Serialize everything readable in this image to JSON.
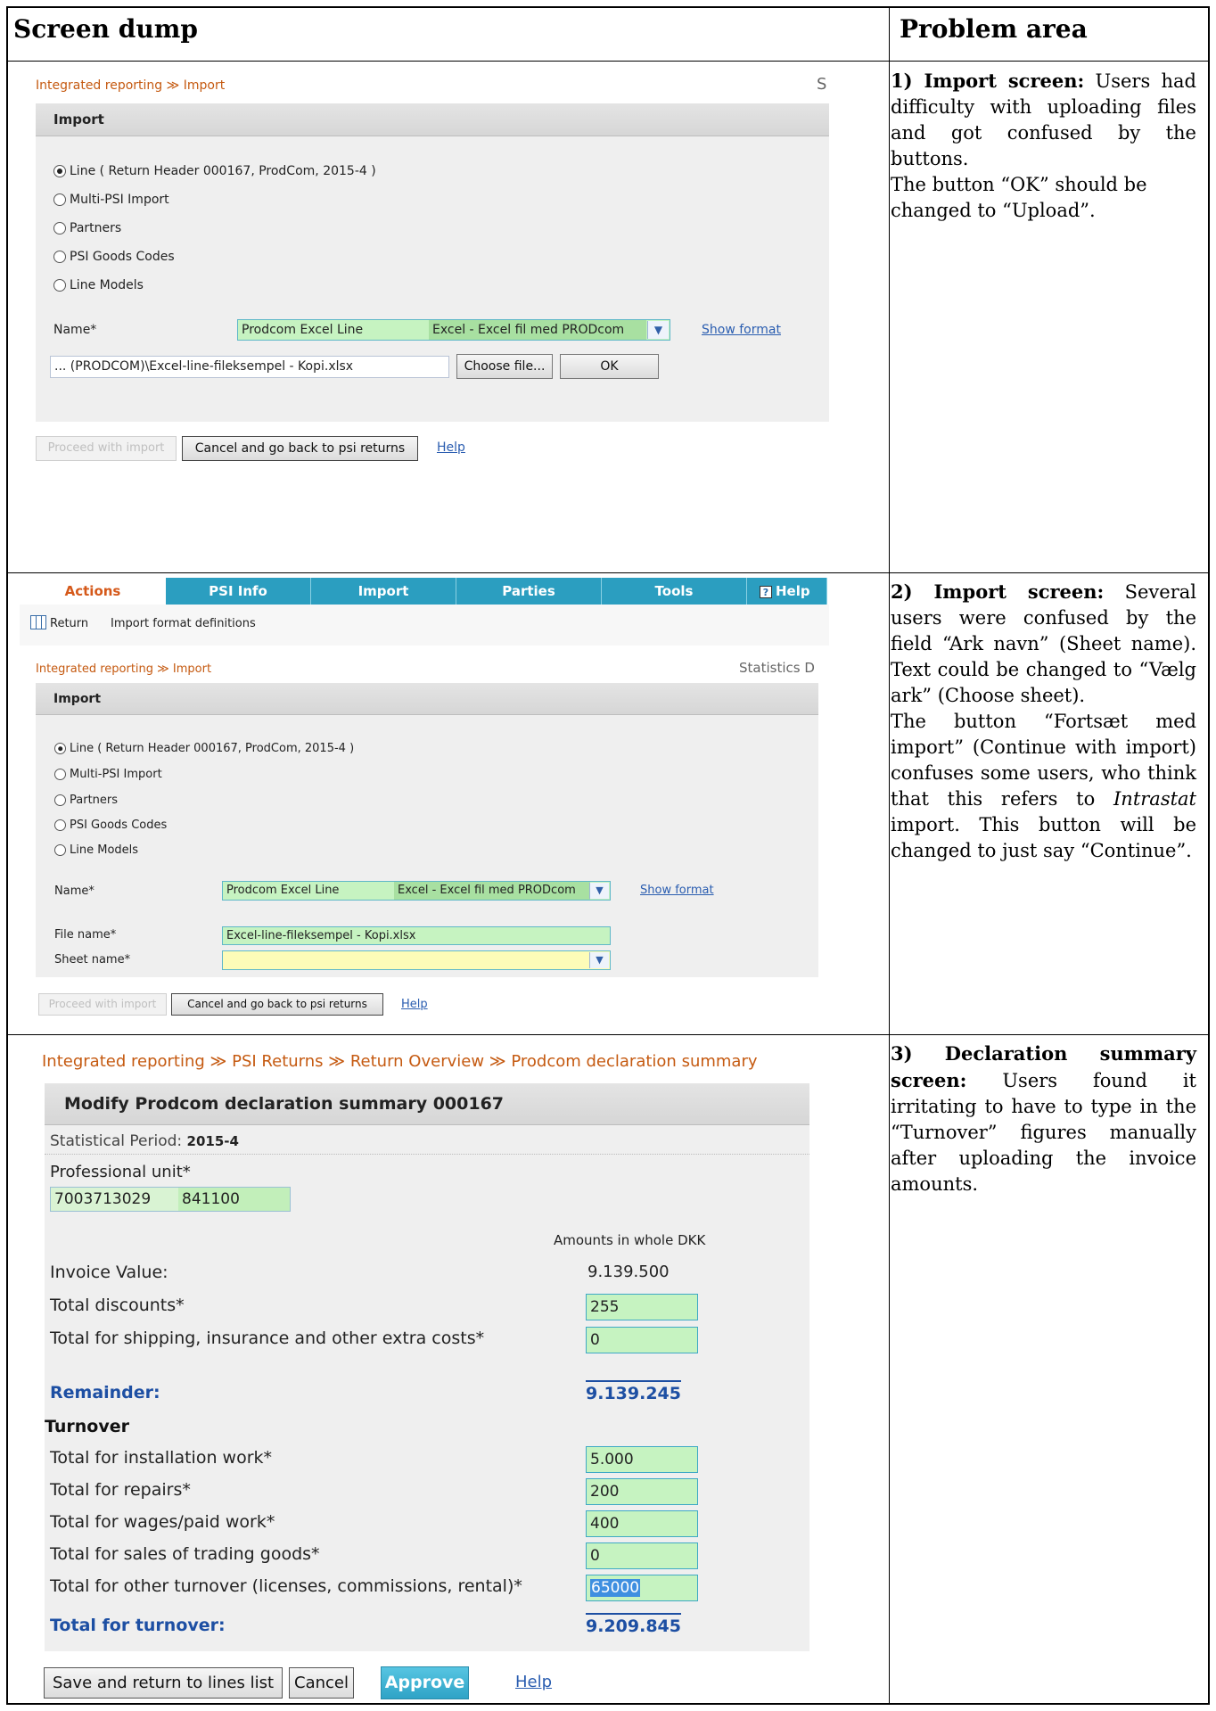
{
  "headers": {
    "left": "Screen dump",
    "right": "Problem area"
  },
  "problems": [
    {
      "num_title": "1) Import screen:",
      "text": "Users had difficulty with uploading files and got confused by the buttons.",
      "text2": "The button “OK” should be changed to “Upload”."
    },
    {
      "num_title": "2) Import screen:",
      "text": "Several users were confused by the field “Ark navn” (Sheet name). Text could be changed to “Vælg ark” (Choose sheet).",
      "text2_a": "The button “Fortsæt med import” (Continue with import) confuses some users, who think that this refers to ",
      "text2_em": "Intrastat",
      "text2_b": " import. This button will be changed to just say “Continue”."
    },
    {
      "num_title": "3) Declaration summary screen:",
      "text": "Users found it irritating to have to type in the “Turnover” figures manually after uploading the invoice amounts."
    }
  ],
  "s1": {
    "crumb1": "Integrated reporting",
    "crumb2": "Import",
    "crumb_right": "S",
    "panel_title": "Import",
    "radios": [
      "Line ( Return Header 000167, ProdCom, 2015-4 )",
      "Multi-PSI Import",
      "Partners",
      "PSI Goods Codes",
      "Line Models"
    ],
    "name_label": "Name*",
    "name_value": "Prodcom Excel Line",
    "name_sub": "Excel - Excel fil med PRODcom",
    "show_format": "Show format",
    "file_value": "... (PRODCOM)\\Excel-line-fileksempel - Kopi.xlsx",
    "choose_file": "Choose file...",
    "ok": "OK",
    "proceed": "Proceed with import",
    "cancel": "Cancel and go back to psi returns",
    "help": "Help"
  },
  "s2": {
    "tabs": [
      "Actions",
      "PSI Info",
      "Import",
      "Parties",
      "Tools",
      "Help"
    ],
    "tool_return": "Return",
    "tool_import_format": "Import format definitions",
    "crumb1": "Integrated reporting",
    "crumb2": "Import",
    "crumb_right": "Statistics D",
    "panel_title": "Import",
    "radios": [
      "Line ( Return Header 000167, ProdCom, 2015-4 )",
      "Multi-PSI Import",
      "Partners",
      "PSI Goods Codes",
      "Line Models"
    ],
    "name_label": "Name*",
    "name_value": "Prodcom Excel Line",
    "name_sub": "Excel - Excel fil med PRODcom",
    "show_format": "Show format",
    "file_label": "File name*",
    "file_value": "Excel-line-fileksempel - Kopi.xlsx",
    "sheet_label": "Sheet name*",
    "proceed": "Proceed with import",
    "cancel": "Cancel and go back to psi returns",
    "help": "Help"
  },
  "s3": {
    "crumbs": [
      "Integrated reporting",
      "PSI Returns",
      "Return Overview",
      "Prodcom declaration summary"
    ],
    "title": "Modify Prodcom declaration summary 000167",
    "period_label": "Statistical Period:",
    "period_value": "2015-4",
    "unit_label": "Professional unit*",
    "unit_a": "7003713029",
    "unit_b": "841100",
    "amounts_note": "Amounts in whole DKK",
    "invoice_label": "Invoice Value:",
    "invoice_value": "9.139.500",
    "discounts_label": "Total discounts*",
    "discounts_value": "255",
    "shipping_label": "Total for shipping, insurance and other extra costs*",
    "shipping_value": "0",
    "remainder_label": "Remainder:",
    "remainder_value": "9.139.245",
    "turnover_heading": "Turnover",
    "install_label": "Total for installation work*",
    "install_value": "5.000",
    "repairs_label": "Total for repairs*",
    "repairs_value": "200",
    "wages_label": "Total for wages/paid work*",
    "wages_value": "400",
    "trading_label": "Total for sales of trading goods*",
    "trading_value": "0",
    "other_label": "Total for other turnover (licenses, commissions, rental)*",
    "other_value": "65000",
    "total_label": "Total for turnover:",
    "total_value": "9.209.845",
    "save": "Save and return to lines list",
    "cancel": "Cancel",
    "approve": "Approve",
    "help": "Help"
  }
}
